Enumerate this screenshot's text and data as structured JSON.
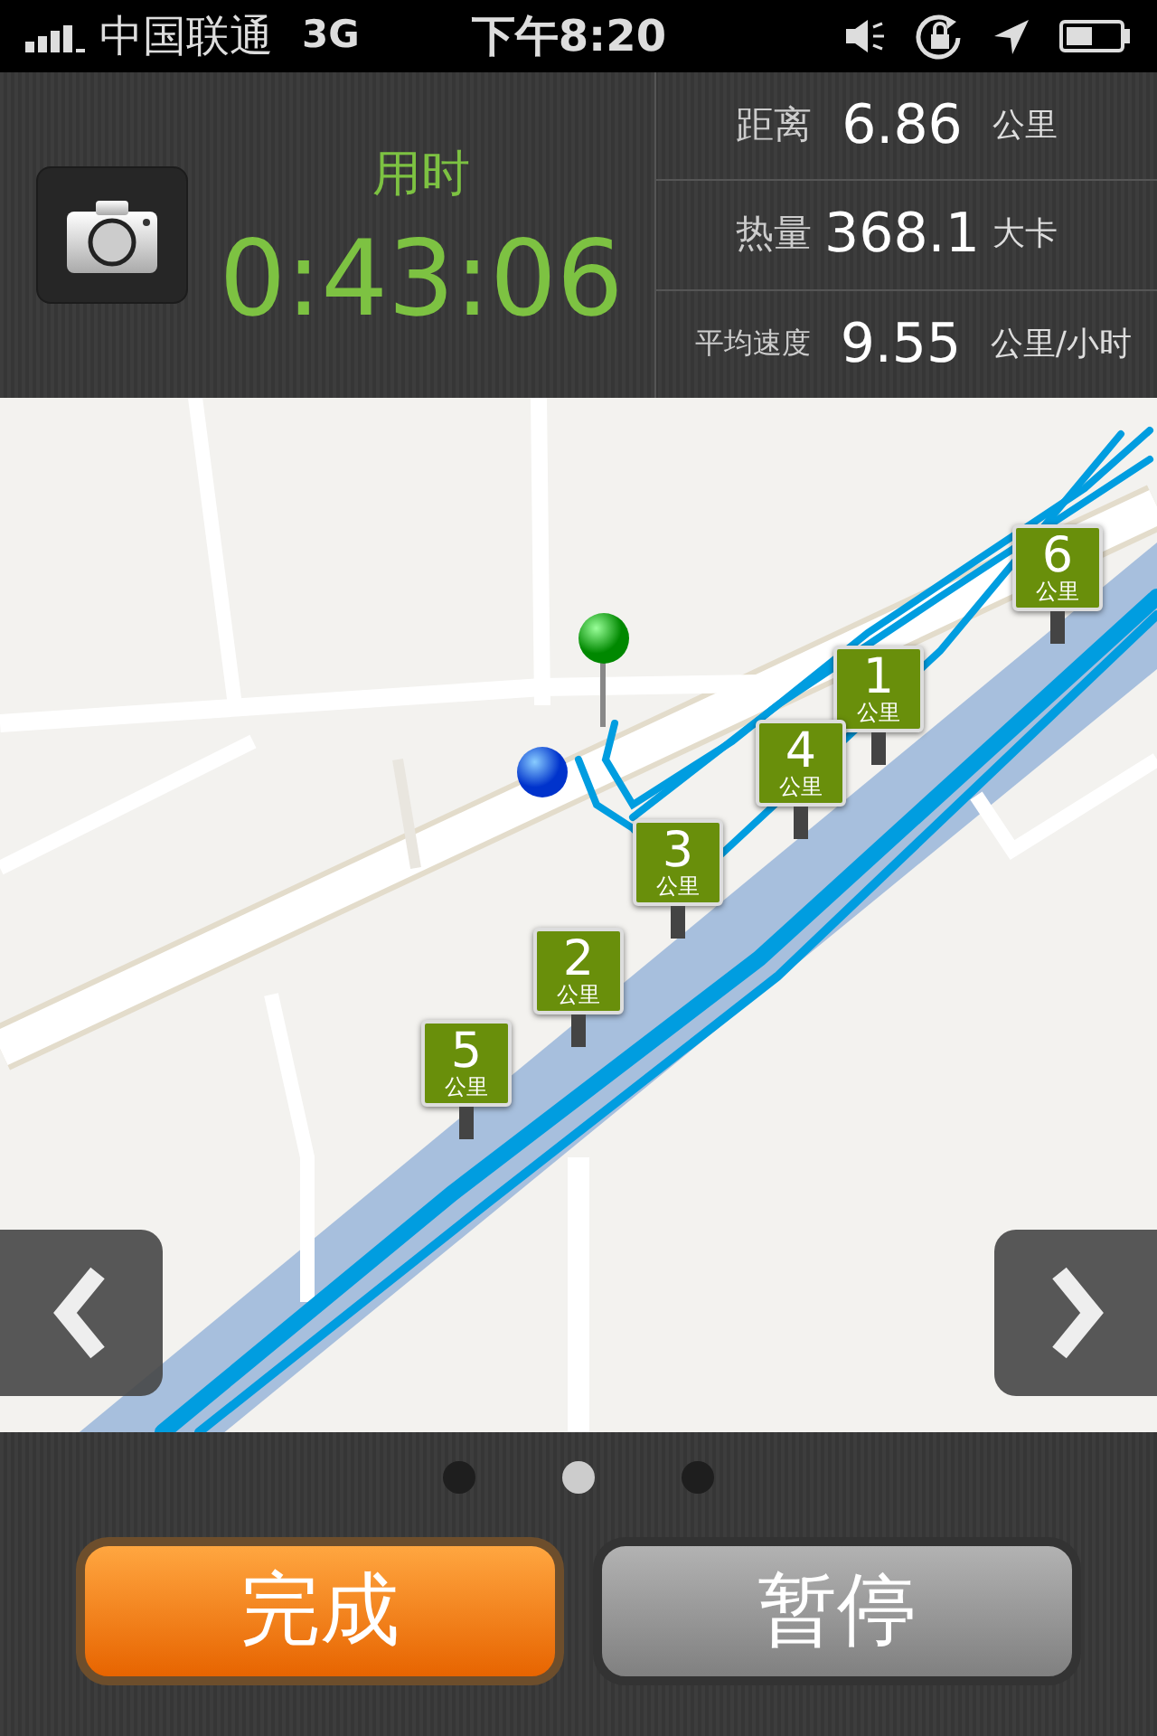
{
  "status_bar": {
    "carrier": "中国联通",
    "network": "3G",
    "time": "下午8:20"
  },
  "workout": {
    "elapsed_label": "用时",
    "elapsed": "0:43:06",
    "stats": [
      {
        "label": "距离",
        "value": "6.86",
        "unit": "公里"
      },
      {
        "label": "热量",
        "value": "368.1",
        "unit": "大卡"
      },
      {
        "label": "平均速度",
        "value": "9.55",
        "unit": "公里/小时"
      }
    ]
  },
  "map": {
    "kind": "picture",
    "markers": [
      {
        "number": "1",
        "unit": "公里"
      },
      {
        "number": "2",
        "unit": "公里"
      },
      {
        "number": "3",
        "unit": "公里"
      },
      {
        "number": "4",
        "unit": "公里"
      },
      {
        "number": "5",
        "unit": "公里"
      },
      {
        "number": "6",
        "unit": "公里"
      }
    ]
  },
  "pages": [
    {
      "selected": false
    },
    {
      "selected": true
    },
    {
      "selected": false
    }
  ],
  "buttons": [
    {
      "label": "完成",
      "kind": "primary"
    },
    {
      "label": "暂停",
      "kind": "secondary"
    }
  ]
}
